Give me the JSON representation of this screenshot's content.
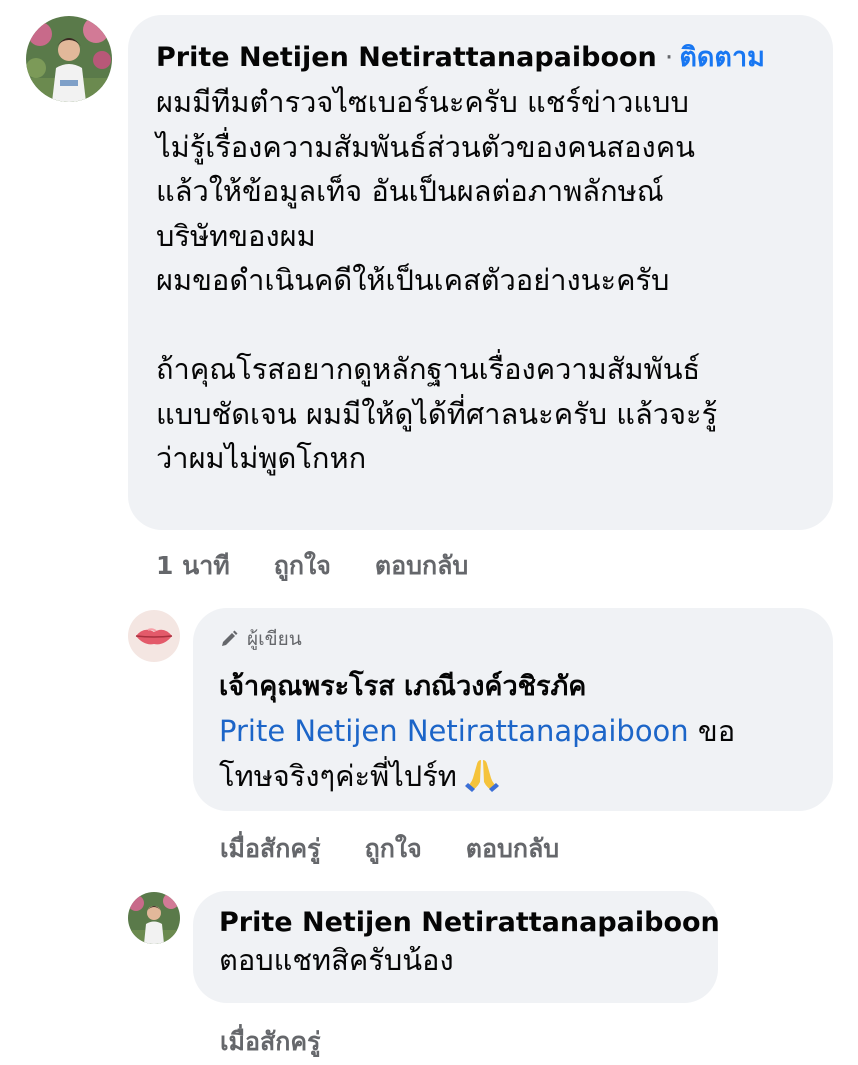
{
  "comment1": {
    "author": "Prite Netijen Netirattanapaiboon",
    "separator": "·",
    "follow_label": "ติดตาม",
    "text": "ผมมีทีมตำรวจไซเบอร์นะครับ แชร์ข่าวแบบ\nไม่รู้เรื่องความสัมพันธ์ส่วนตัวของคนสองคน\nแล้วให้ข้อมูลเท็จ อันเป็นผลต่อภาพลักษณ์\nบริษัทของผม\nผมขอดำเนินคดีให้เป็นเคสตัวอย่างนะครับ\n\nถ้าคุณโรสอยากดูหลักฐานเรื่องความสัมพันธ์\nแบบชัดเจน ผมมีให้ดูได้ที่ศาลนะครับ แล้วจะรู้\nว่าผมไม่พูดโกหก",
    "time": "1 นาที",
    "like_label": "ถูกใจ",
    "reply_label": "ตอบกลับ"
  },
  "reply1": {
    "badge_icon": "pencil-icon",
    "badge_label": "ผู้เขียน",
    "author": "เจ้าคุณพระโรส เภณีวงค์วชิรภัค",
    "mention": "Prite Netijen Netirattanapaiboon",
    "text_after_mention": " ขอ\nโทษจริงๆค่ะพี่ไปร์ท",
    "emoji": "folded-hands-emoji",
    "time": "เมื่อสักครู่",
    "like_label": "ถูกใจ",
    "reply_label": "ตอบกลับ"
  },
  "reply2": {
    "author": "Prite Netijen Netirattanapaiboon",
    "text": "ตอบแชทสิครับน้อง",
    "time": "เมื่อสักครู่"
  },
  "colors": {
    "bubble": "#f0f2f5",
    "link": "#1877f2",
    "mention": "#1c65c8",
    "meta": "#65676b"
  }
}
